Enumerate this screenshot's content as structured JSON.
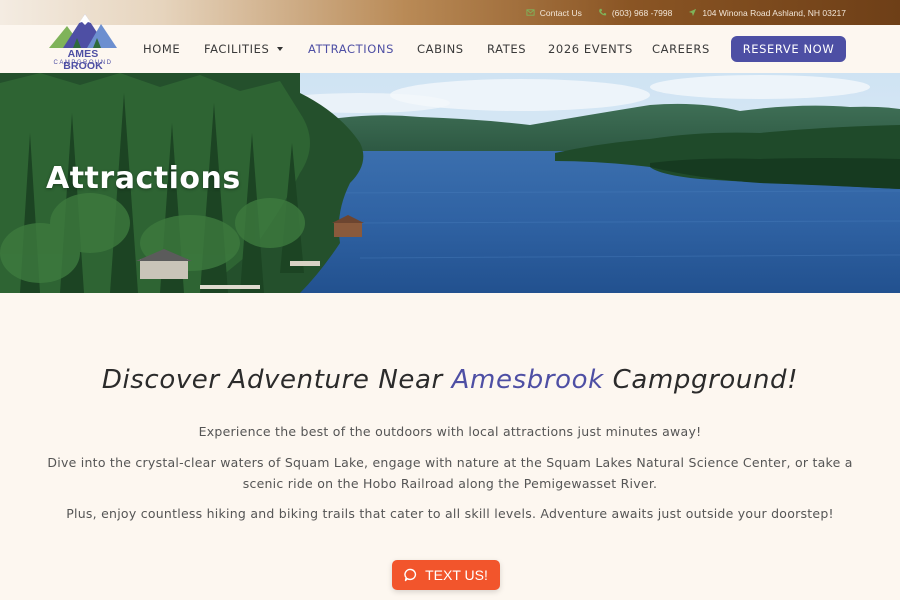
{
  "topbar": {
    "contact": "Contact Us",
    "phone": "(603) 968 -7998",
    "address": "104 Winona Road Ashland, NH 03217",
    "icon_color": "#7fb35a"
  },
  "logo": {
    "title": "AMES BROOK",
    "subtitle": "CAMPGROUND"
  },
  "nav": {
    "items": [
      {
        "label": "HOME"
      },
      {
        "label": "FACILITIES"
      },
      {
        "label": "ATTRACTIONS"
      },
      {
        "label": "CABINS"
      },
      {
        "label": "RATES"
      },
      {
        "label": "2026 EVENTS"
      },
      {
        "label": "CAREERS"
      }
    ],
    "active": "ATTRACTIONS",
    "cta": "RESERVE NOW"
  },
  "hero": {
    "title": "Attractions"
  },
  "main": {
    "headline_pre": "Discover Adventure Near ",
    "headline_accent": "Amesbrook",
    "headline_post": " Campground!",
    "p1": "Experience the best of the outdoors with local attractions just minutes away!",
    "p2": "Dive into the crystal-clear waters of Squam Lake, engage with nature at the Squam Lakes Natural Science Center, or take a scenic ride on the Hobo Railroad along the Pemigewasset River.",
    "p3": "Plus, enjoy countless hiking and biking trails that cater to all skill levels. Adventure awaits just outside your doorstep!"
  },
  "chat": {
    "label": "TEXT US!"
  },
  "colors": {
    "brand": "#4e4fa4",
    "cta_orange": "#f2552c",
    "background": "#fdf7f0"
  }
}
